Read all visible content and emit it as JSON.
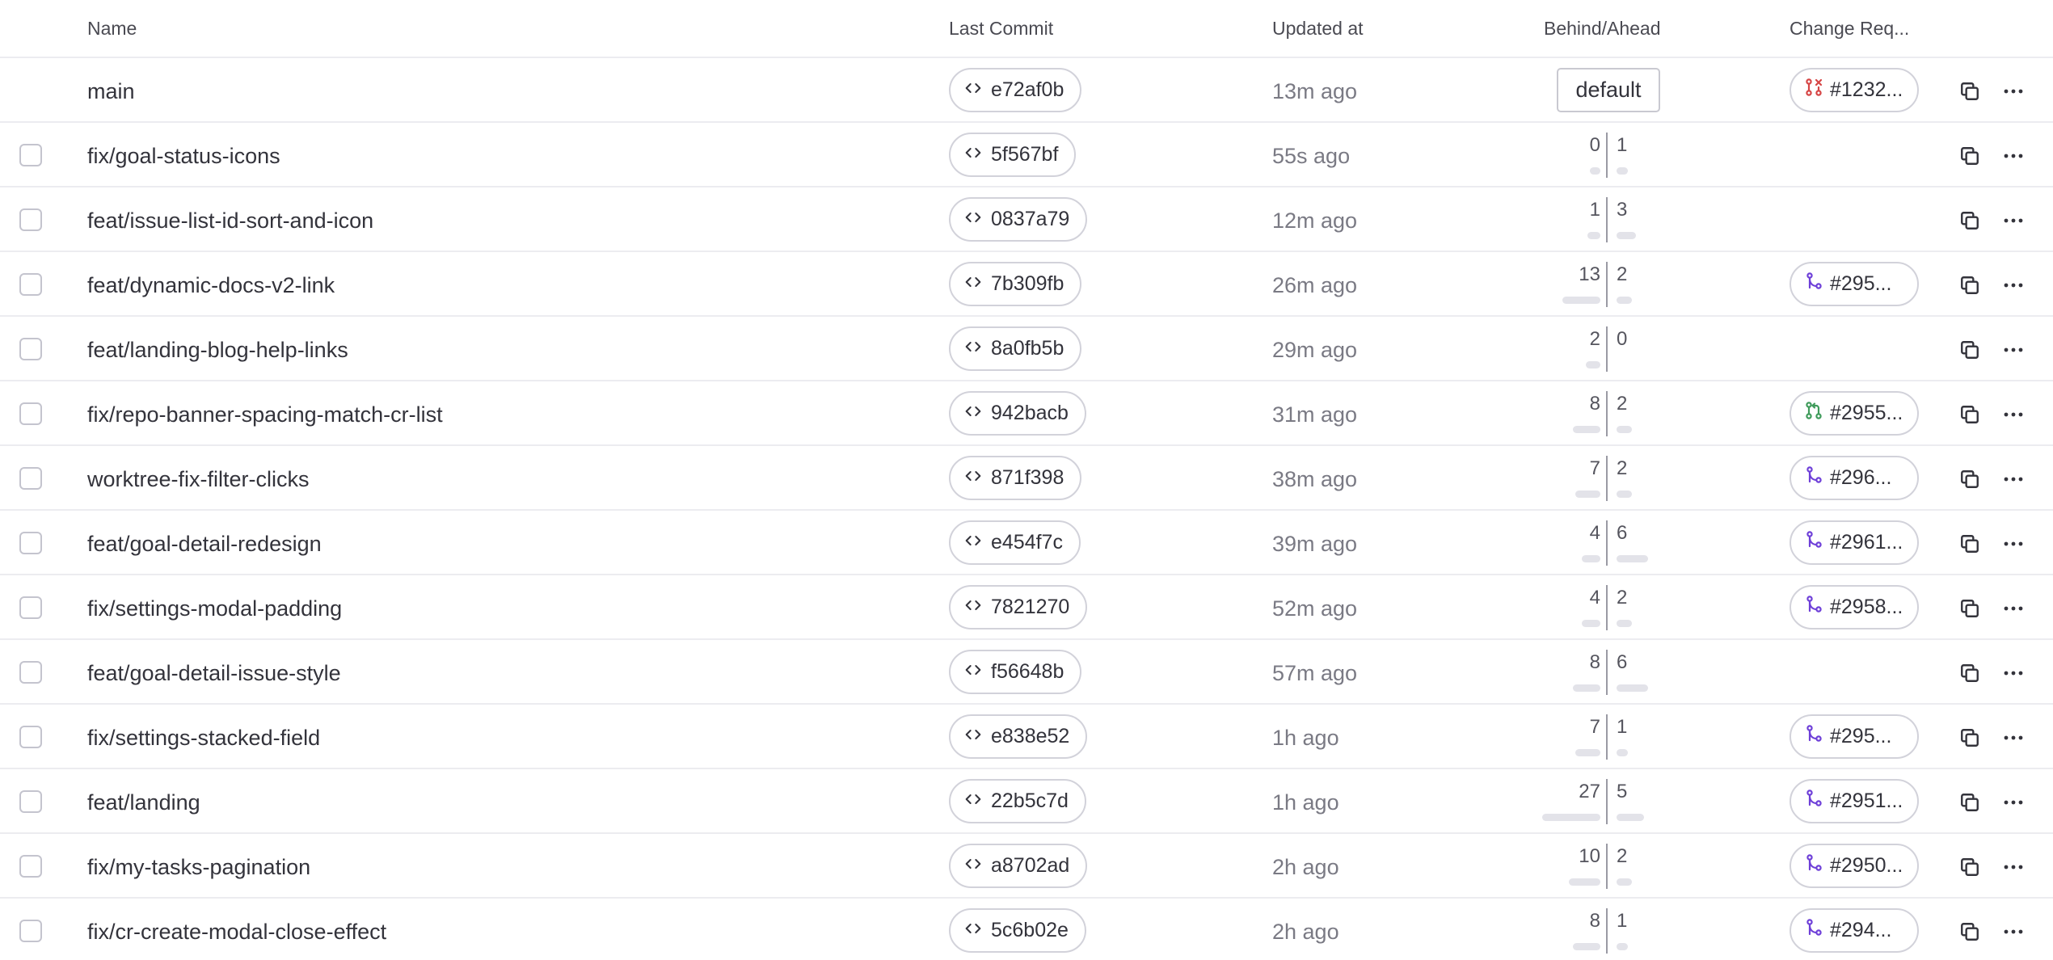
{
  "headers": {
    "name": "Name",
    "last_commit": "Last Commit",
    "updated_at": "Updated at",
    "behind_ahead": "Behind/Ahead",
    "change_requests": "Change Req..."
  },
  "icons": {
    "commit": "code-icon",
    "copy": "copy-icon",
    "more": "more-icon",
    "cr_open": "pull-request-icon",
    "cr_closed": "pull-request-closed-icon",
    "cr_merged": "merge-icon"
  },
  "colors": {
    "cr_closed": "#d64545",
    "cr_open": "#3f9b5b",
    "cr_merged": "#6e3fd8",
    "bar": "#e3e3e9"
  },
  "branches": [
    {
      "name": "main",
      "commit": "e72af0b",
      "updated": "13m ago",
      "is_default": true,
      "default_label": "default",
      "cr_label": "#1232...",
      "cr_status": "closed"
    },
    {
      "name": "fix/goal-status-icons",
      "commit": "5f567bf",
      "updated": "55s ago",
      "behind": 0,
      "ahead": 1
    },
    {
      "name": "feat/issue-list-id-sort-and-icon",
      "commit": "0837a79",
      "updated": "12m ago",
      "behind": 1,
      "ahead": 3
    },
    {
      "name": "feat/dynamic-docs-v2-link",
      "commit": "7b309fb",
      "updated": "26m ago",
      "behind": 13,
      "ahead": 2,
      "cr_label": "#295...",
      "cr_status": "merged"
    },
    {
      "name": "feat/landing-blog-help-links",
      "commit": "8a0fb5b",
      "updated": "29m ago",
      "behind": 2,
      "ahead": 0
    },
    {
      "name": "fix/repo-banner-spacing-match-cr-list",
      "commit": "942bacb",
      "updated": "31m ago",
      "behind": 8,
      "ahead": 2,
      "cr_label": "#2955...",
      "cr_status": "open"
    },
    {
      "name": "worktree-fix-filter-clicks",
      "commit": "871f398",
      "updated": "38m ago",
      "behind": 7,
      "ahead": 2,
      "cr_label": "#296...",
      "cr_status": "merged"
    },
    {
      "name": "feat/goal-detail-redesign",
      "commit": "e454f7c",
      "updated": "39m ago",
      "behind": 4,
      "ahead": 6,
      "cr_label": "#2961...",
      "cr_status": "merged"
    },
    {
      "name": "fix/settings-modal-padding",
      "commit": "7821270",
      "updated": "52m ago",
      "behind": 4,
      "ahead": 2,
      "cr_label": "#2958...",
      "cr_status": "merged"
    },
    {
      "name": "feat/goal-detail-issue-style",
      "commit": "f56648b",
      "updated": "57m ago",
      "behind": 8,
      "ahead": 6
    },
    {
      "name": "fix/settings-stacked-field",
      "commit": "e838e52",
      "updated": "1h ago",
      "behind": 7,
      "ahead": 1,
      "cr_label": "#295...",
      "cr_status": "merged"
    },
    {
      "name": "feat/landing",
      "commit": "22b5c7d",
      "updated": "1h ago",
      "behind": 27,
      "ahead": 5,
      "cr_label": "#2951...",
      "cr_status": "merged"
    },
    {
      "name": "fix/my-tasks-pagination",
      "commit": "a8702ad",
      "updated": "2h ago",
      "behind": 10,
      "ahead": 2,
      "cr_label": "#2950...",
      "cr_status": "merged"
    },
    {
      "name": "fix/cr-create-modal-close-effect",
      "commit": "5c6b02e",
      "updated": "2h ago",
      "behind": 8,
      "ahead": 1,
      "cr_label": "#294...",
      "cr_status": "merged"
    }
  ]
}
